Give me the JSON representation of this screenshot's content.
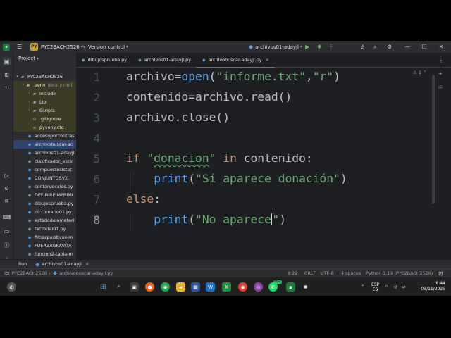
{
  "titlebar": {
    "project_badge": "PY",
    "project_name": "PYC2BACH2526",
    "vcs": "Version control",
    "run_config": "archivos01-adayjl"
  },
  "project_panel": {
    "title": "Project",
    "root": "PYC2BACH2526",
    "venv": ".venv",
    "venv_note": "library root",
    "items": [
      {
        "label": "include",
        "type": "folder"
      },
      {
        "label": "Lib",
        "type": "folder"
      },
      {
        "label": "Scripts",
        "type": "folder"
      },
      {
        "label": ".gitignore",
        "type": "file"
      },
      {
        "label": "pyvenv.cfg",
        "type": "file"
      },
      {
        "label": "accesoporcontras",
        "type": "py"
      },
      {
        "label": "archivobuscar-ac",
        "type": "py"
      },
      {
        "label": "archivos01-adayjl",
        "type": "py"
      },
      {
        "label": "clasificador_estel",
        "type": "py"
      },
      {
        "label": "compuestosistat",
        "type": "py"
      },
      {
        "label": "CONJUNTOSV2.",
        "type": "py"
      },
      {
        "label": "contarvocales.py",
        "type": "py"
      },
      {
        "label": "DEFINIREIMPRIMI",
        "type": "py"
      },
      {
        "label": "dibujosprueba.py",
        "type": "py"
      },
      {
        "label": "diccionario01.py",
        "type": "py"
      },
      {
        "label": "estadodelamateri",
        "type": "py"
      },
      {
        "label": "factorial01.py",
        "type": "py"
      },
      {
        "label": "filtrarpositivos-m",
        "type": "py"
      },
      {
        "label": "FUERZAGRAVITA",
        "type": "py"
      },
      {
        "label": "funcion2-tabla-m",
        "type": "py"
      }
    ]
  },
  "tabs": [
    {
      "label": "dibujosprueba.py"
    },
    {
      "label": "archivos01-adayjl.py"
    },
    {
      "label": "archivobuscar-adayjl.py"
    }
  ],
  "editor": {
    "problems": "1",
    "line_numbers": [
      "1",
      "2",
      "3",
      "4",
      "5",
      "6",
      "7",
      "8"
    ],
    "lines": {
      "l1": {
        "a": "archivo=",
        "b": "open",
        "c": "(",
        "d": "\"informe.txt\"",
        "e": ",",
        "f": "\"r\"",
        "g": ")"
      },
      "l2": {
        "a": "contenido=archivo.read()"
      },
      "l3": {
        "a": "archivo.close()"
      },
      "l5": {
        "a": "if ",
        "b": "\"",
        "c": "donacion",
        "d": "\"",
        "e": " in ",
        "f": "contenido:"
      },
      "l6": {
        "a": "    ",
        "b": "print",
        "c": "(",
        "d": "\"Sí aparece donación\"",
        "e": ")"
      },
      "l7": {
        "a": "else",
        "b": ":"
      },
      "l8": {
        "a": "    ",
        "b": "print",
        "c": "(",
        "d": "\"No aparece",
        "e": "\"",
        "f": ")"
      }
    }
  },
  "runbar": {
    "label": "Run",
    "tab": "archivos01-adayjl"
  },
  "statusbar": {
    "breadcrumb_project": "PYC2BACH2526",
    "breadcrumb_file": "archivobuscar-adayjl.py",
    "position": "8:22",
    "line_sep": "CRLF",
    "encoding": "UTF-8",
    "indent": "4 spaces",
    "interpreter": "Python 3.13 (PYC2BACH2526)"
  },
  "taskbar": {
    "lang_top": "ESP",
    "lang_bottom": "ES",
    "time": "8:44",
    "date": "03/11/2025",
    "badge": "99+"
  },
  "colors": {
    "keyword": "#cf8e6d",
    "string": "#6aab73",
    "function": "#56a8f5",
    "accent": "#3574f0"
  }
}
